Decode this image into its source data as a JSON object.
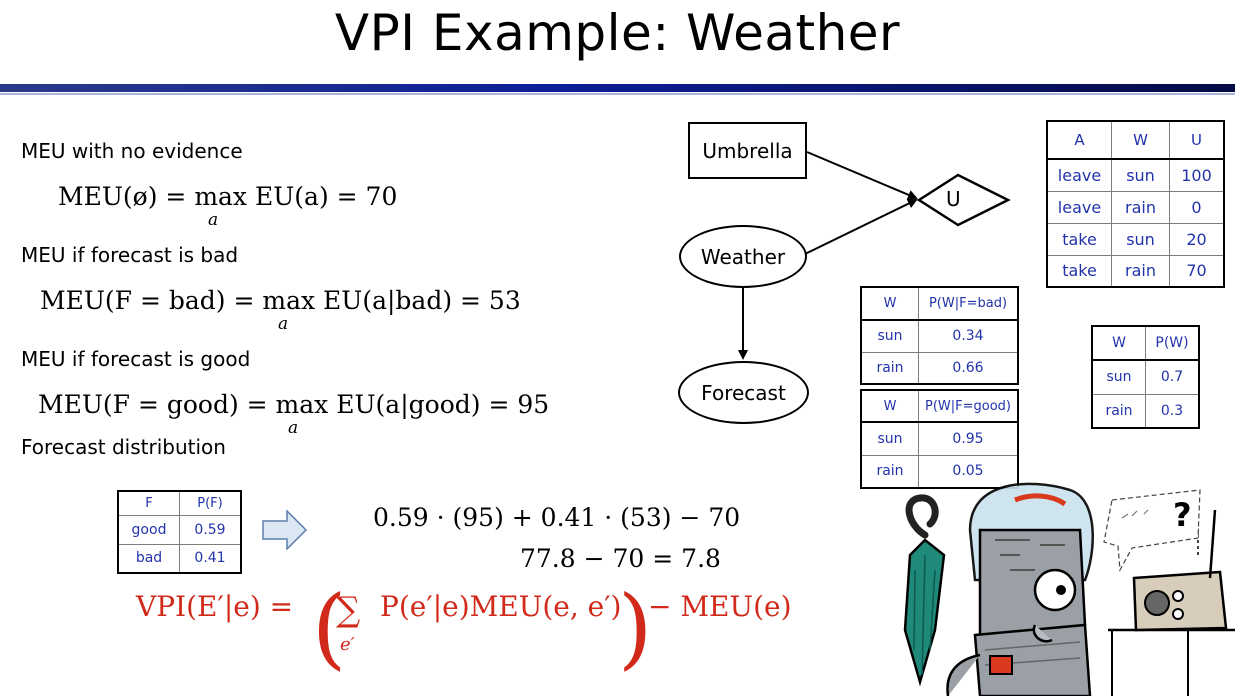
{
  "title": "VPI Example: Weather",
  "left": {
    "no_evidence_label": "MEU with no evidence",
    "eq1": {
      "lhs": "MEU(ø) = max",
      "sub": "a",
      "rhs": "EU(a) = 70"
    },
    "bad_label": "MEU if forecast is bad",
    "eq2": {
      "lhs": "MEU(F = bad) = max",
      "sub": "a",
      "rhs": "EU(a|bad) = 53"
    },
    "good_label": "MEU if forecast is good",
    "eq3": {
      "lhs": "MEU(F = good) = max",
      "sub": "a",
      "rhs": "EU(a|good) = 95"
    },
    "dist_label": "Forecast distribution"
  },
  "forecast_table": {
    "headers": [
      "F",
      "P(F)"
    ],
    "rows": [
      [
        "good",
        "0.59"
      ],
      [
        "bad",
        "0.41"
      ]
    ]
  },
  "calc": {
    "line1": "0.59 · (95) + 0.41 · (53) − 70",
    "line2": "77.8 − 70 = 7.8"
  },
  "vpi": {
    "lhs": "VPI(E′|e) = ",
    "sum_symbol": "∑",
    "sum_sub": "e′",
    "inner": "P(e′|e)MEU(e, e′)",
    "rhs": "− MEU(e)"
  },
  "network": {
    "umbrella": "Umbrella",
    "utility": "U",
    "weather": "Weather",
    "forecast": "Forecast"
  },
  "utility_table": {
    "headers": [
      "A",
      "W",
      "U"
    ],
    "rows": [
      [
        "leave",
        "sun",
        "100"
      ],
      [
        "leave",
        "rain",
        "0"
      ],
      [
        "take",
        "sun",
        "20"
      ],
      [
        "take",
        "rain",
        "70"
      ]
    ]
  },
  "w_bad_table": {
    "headers": [
      "W",
      "P(W|F=bad)"
    ],
    "rows": [
      [
        "sun",
        "0.34"
      ],
      [
        "rain",
        "0.66"
      ]
    ]
  },
  "w_good_table": {
    "headers": [
      "W",
      "P(W|F=good)"
    ],
    "rows": [
      [
        "sun",
        "0.95"
      ],
      [
        "rain",
        "0.05"
      ]
    ]
  },
  "prior_table": {
    "headers": [
      "W",
      "P(W)"
    ],
    "rows": [
      [
        "sun",
        "0.7"
      ],
      [
        "rain",
        "0.3"
      ]
    ]
  },
  "illustration": {
    "speech_text": "?",
    "icons": [
      "robot-icon",
      "umbrella-icon",
      "radio-icon"
    ],
    "colors": {
      "umbrella": "#1f8a7a",
      "robot_body": "#9aa0a6",
      "radio": "#d8cdbb"
    }
  }
}
